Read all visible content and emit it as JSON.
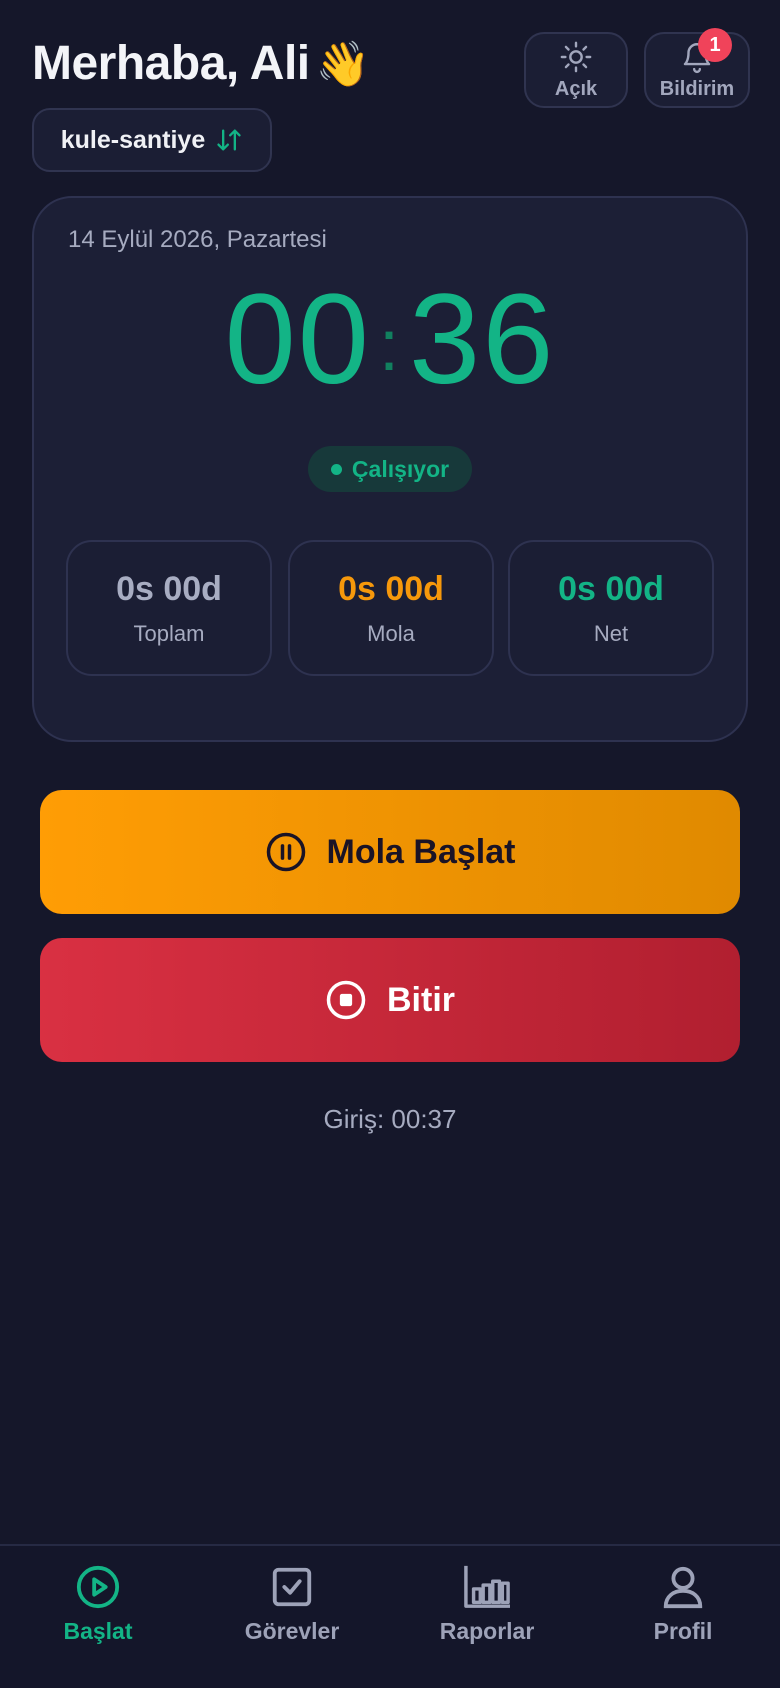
{
  "header": {
    "greeting": "Merhaba, Ali",
    "wave_emoji": "👋",
    "theme_button": {
      "label": "Açık",
      "icon": "sun-icon"
    },
    "notification_button": {
      "label": "Bildirim",
      "icon": "bell-icon",
      "badge": "1"
    }
  },
  "site_selector": {
    "label": "kule-santiye",
    "icon": "swap-vertical-icon"
  },
  "card": {
    "date": "14 Eylül 2026, Pazartesi",
    "timer": {
      "hours": "00",
      "minutes": "36"
    },
    "status": "Çalışıyor",
    "stats": {
      "total": {
        "value": "0s 00d",
        "label": "Toplam"
      },
      "break": {
        "value": "0s 00d",
        "label": "Mola"
      },
      "net": {
        "value": "0s 00d",
        "label": "Net"
      }
    }
  },
  "actions": {
    "break_label": "Mola Başlat",
    "finish_label": "Bitir"
  },
  "checkin": "Giriş: 00:37",
  "nav": {
    "start": "Başlat",
    "tasks": "Görevler",
    "reports": "Raporlar",
    "profile": "Profil"
  },
  "colors": {
    "background": "#15172a",
    "accent_green": "#13b486",
    "break_orange": "#f6980b",
    "finish_red": "#d93042",
    "badge_red": "#f0435a"
  }
}
